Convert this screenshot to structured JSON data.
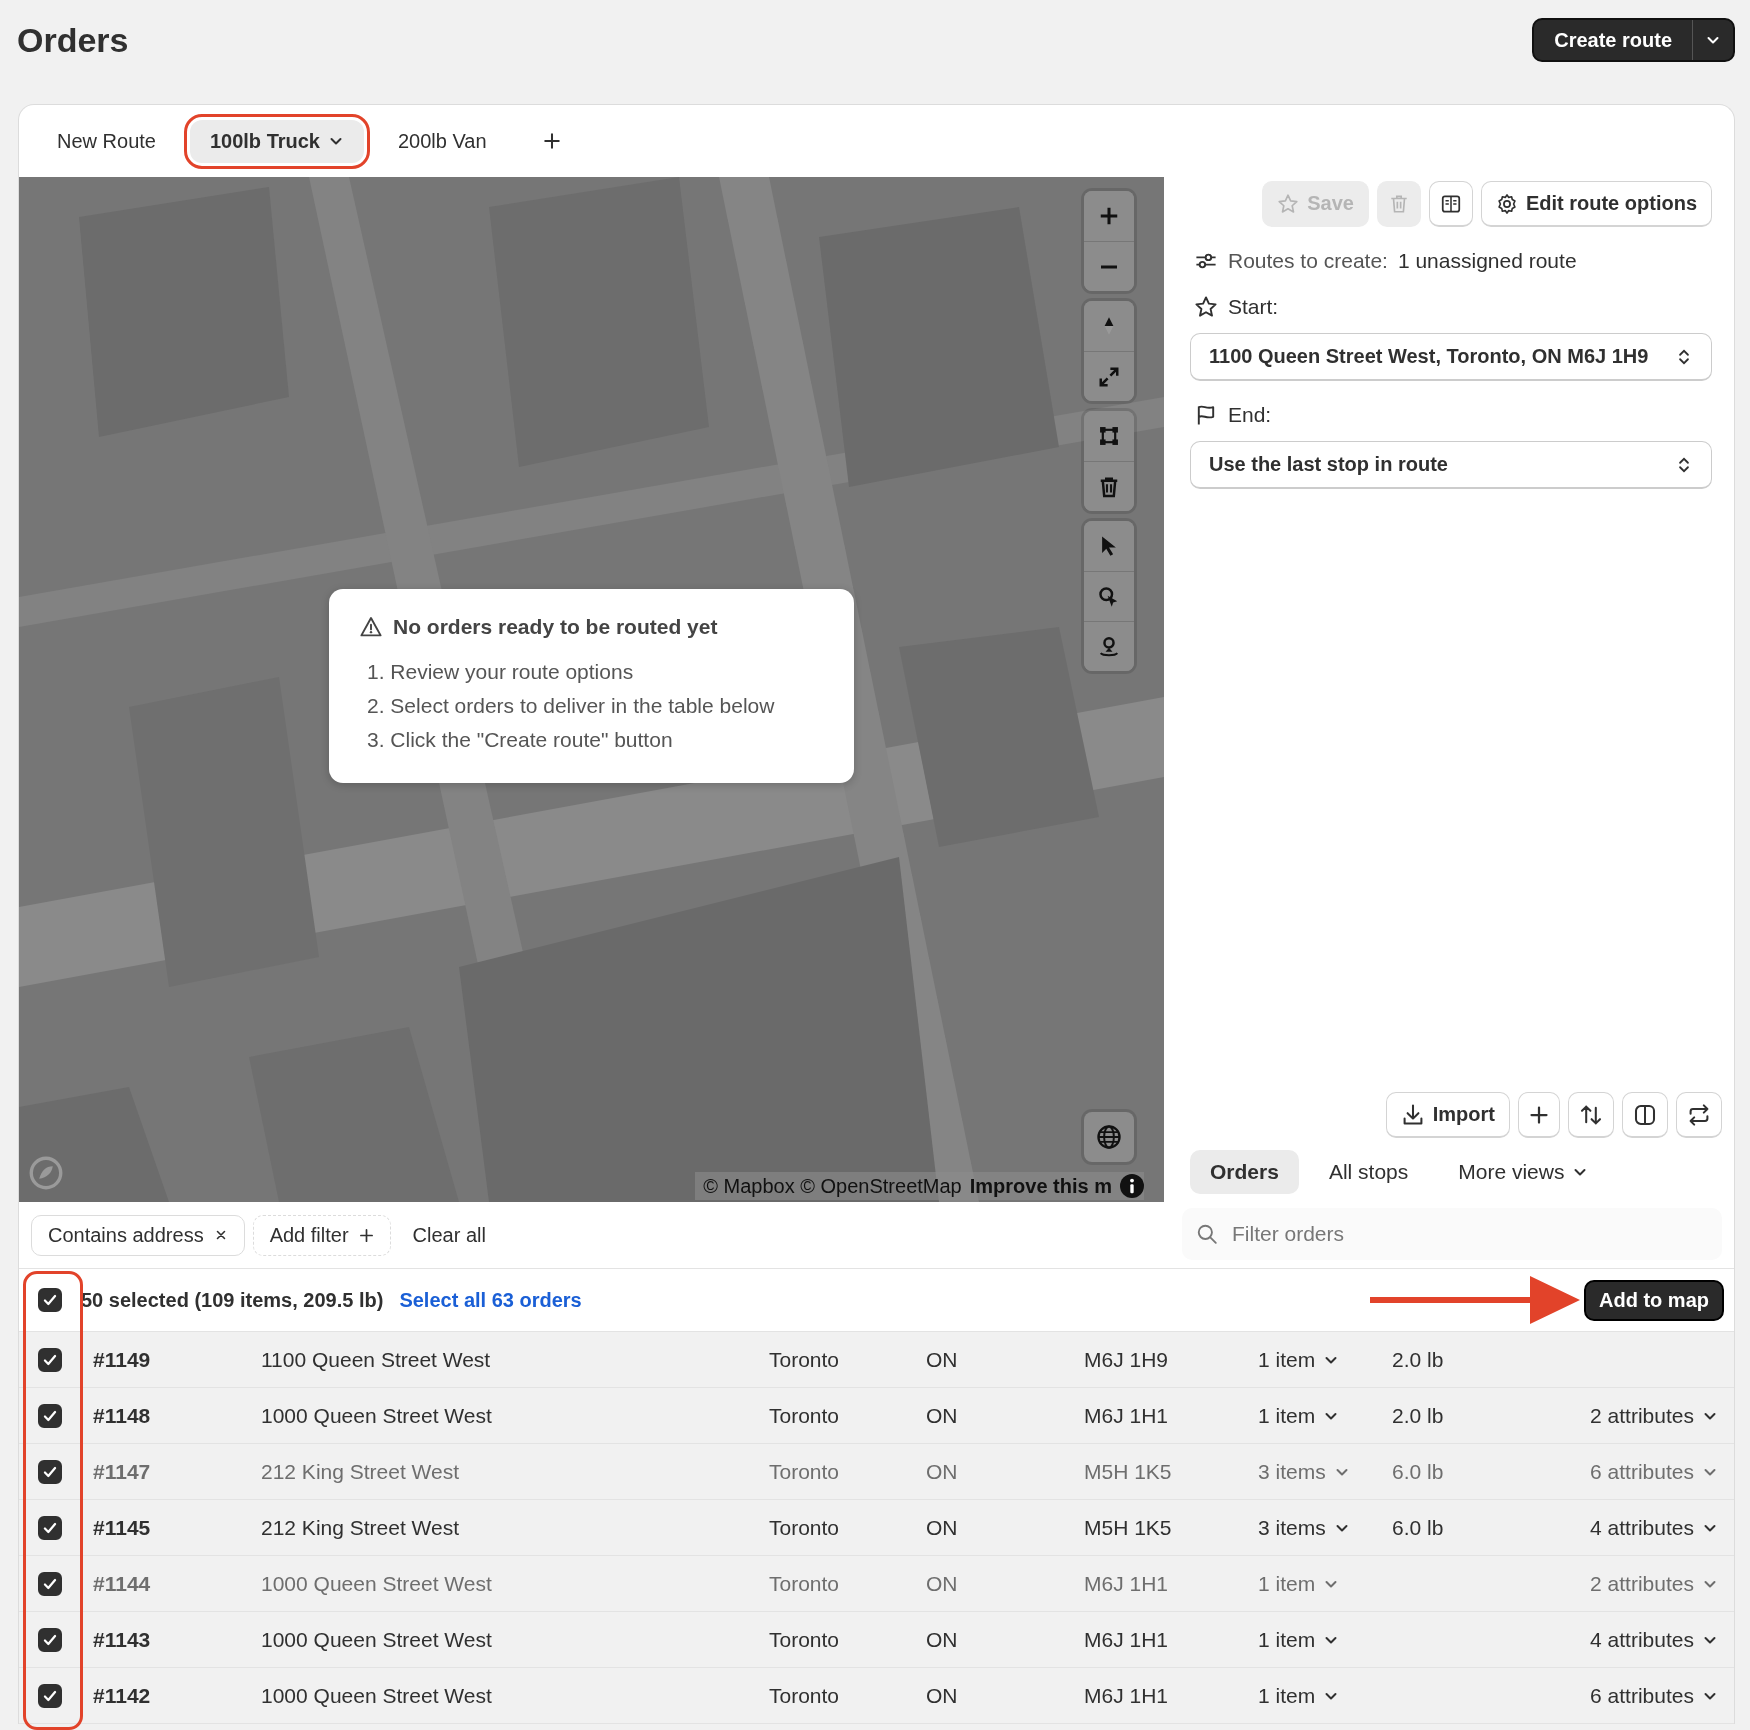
{
  "page": {
    "title": "Orders"
  },
  "primary_action": {
    "label": "Create route"
  },
  "route_tabs": [
    {
      "label": "New Route",
      "selected": false,
      "annotated": false,
      "has_menu": false
    },
    {
      "label": "100lb Truck",
      "selected": true,
      "annotated": true,
      "has_menu": true
    },
    {
      "label": "200lb Van",
      "selected": false,
      "annotated": false,
      "has_menu": false
    }
  ],
  "map": {
    "kind": "picture",
    "popup": {
      "title": "No orders ready to be routed yet",
      "steps": [
        "1. Review your route options",
        "2. Select orders to deliver in the table below",
        "3. Click the \"Create route\" button"
      ]
    },
    "attribution": "© Mapbox © OpenStreetMap",
    "improve_link": "Improve this m"
  },
  "route_toolbar": {
    "save": {
      "label": "Save",
      "disabled": true
    },
    "delete_disabled": true,
    "edit_options": "Edit route options"
  },
  "routes_to_create": {
    "label": "Routes to create:",
    "value": "1 unassigned route"
  },
  "start": {
    "label": "Start:",
    "value": "1100 Queen Street West, Toronto, ON M6J 1H9"
  },
  "end": {
    "label": "End:",
    "value": "Use the last stop in route"
  },
  "import_button": "Import",
  "views": [
    {
      "label": "Orders",
      "selected": true,
      "has_menu": false
    },
    {
      "label": "All stops",
      "selected": false,
      "has_menu": false
    },
    {
      "label": "More views",
      "selected": false,
      "has_menu": true
    }
  ],
  "filter_search": {
    "placeholder": "Filter orders"
  },
  "filters": [
    {
      "kind": "chip",
      "label": "Contains address"
    },
    {
      "kind": "add",
      "label": "Add filter"
    },
    {
      "kind": "clear",
      "label": "Clear all"
    }
  ],
  "selection": {
    "checked": true,
    "summary": "50 selected (109 items, 209.5 lb)",
    "select_all_link": "Select all 63 orders",
    "action": "Add to map"
  },
  "annotations": {
    "checkbox_column": true,
    "arrow": true
  },
  "orders": [
    {
      "id": "#1149",
      "address": "1100 Queen Street West",
      "city": "Toronto",
      "province": "ON",
      "postal": "M6J 1H9",
      "items": "1 item",
      "weight": "2.0 lb",
      "checked": true,
      "muted": false
    },
    {
      "id": "#1148",
      "address": "1000 Queen Street West",
      "city": "Toronto",
      "province": "ON",
      "postal": "M6J 1H1",
      "items": "1 item",
      "weight": "2.0 lb",
      "attributes": "2 attributes",
      "checked": true,
      "muted": false
    },
    {
      "id": "#1147",
      "address": "212 King Street West",
      "city": "Toronto",
      "province": "ON",
      "postal": "M5H 1K5",
      "items": "3 items",
      "weight": "6.0 lb",
      "attributes": "6 attributes",
      "checked": true,
      "muted": true
    },
    {
      "id": "#1145",
      "address": "212 King Street West",
      "city": "Toronto",
      "province": "ON",
      "postal": "M5H 1K5",
      "items": "3 items",
      "weight": "6.0 lb",
      "attributes": "4 attributes",
      "checked": true,
      "muted": false
    },
    {
      "id": "#1144",
      "address": "1000 Queen Street West",
      "city": "Toronto",
      "province": "ON",
      "postal": "M6J 1H1",
      "items": "1 item",
      "attributes": "2 attributes",
      "checked": true,
      "muted": true
    },
    {
      "id": "#1143",
      "address": "1000 Queen Street West",
      "city": "Toronto",
      "province": "ON",
      "postal": "M6J 1H1",
      "items": "1 item",
      "attributes": "4 attributes",
      "checked": true,
      "muted": false
    },
    {
      "id": "#1142",
      "address": "1000 Queen Street West",
      "city": "Toronto",
      "province": "ON",
      "postal": "M6J 1H1",
      "items": "1 item",
      "attributes": "6 attributes",
      "checked": true,
      "muted": false
    }
  ]
}
